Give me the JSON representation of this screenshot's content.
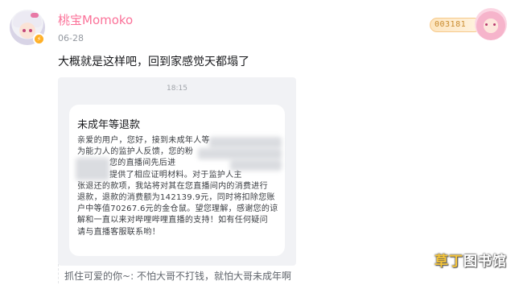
{
  "post": {
    "username": "桃宝Momoko",
    "date": "06-28",
    "text": "大概就是这样吧，回到家感觉天都塌了",
    "level_badge": "⚡",
    "fan_badge": {
      "number": "003181"
    }
  },
  "screenshot": {
    "time": "18:15",
    "card": {
      "title": "未成年等退款",
      "lines": [
        "亲爱的用户，您好，接到未成年人等",
        "为能力人的监护人反馈，您的粉",
        "您的直播间先后进",
        "提供了相应证明材料。对于监护人主",
        "张退还的款项，我站将对其在您直播间内的消费进行",
        "退款，退款的消费额为142139.9元，同时将扣除您账",
        "户中等值70267.6元的金仓鼠。望您理解，感谢您的谅",
        "解和一直以来对哔哩哔哩直播的支持！如有任何疑问",
        "请与直播客服联系哟！"
      ]
    }
  },
  "reply": {
    "author": "抓住可爱的你",
    "separator": "~:",
    "text": "不怕大哥不打钱，就怕大哥未成年啊"
  },
  "watermark": {
    "accent": "草丁",
    "rest": "图书馆"
  },
  "colors": {
    "username": "#fb7299",
    "badge": "#ffb027",
    "text": "#18191c",
    "muted": "#9499a0"
  }
}
